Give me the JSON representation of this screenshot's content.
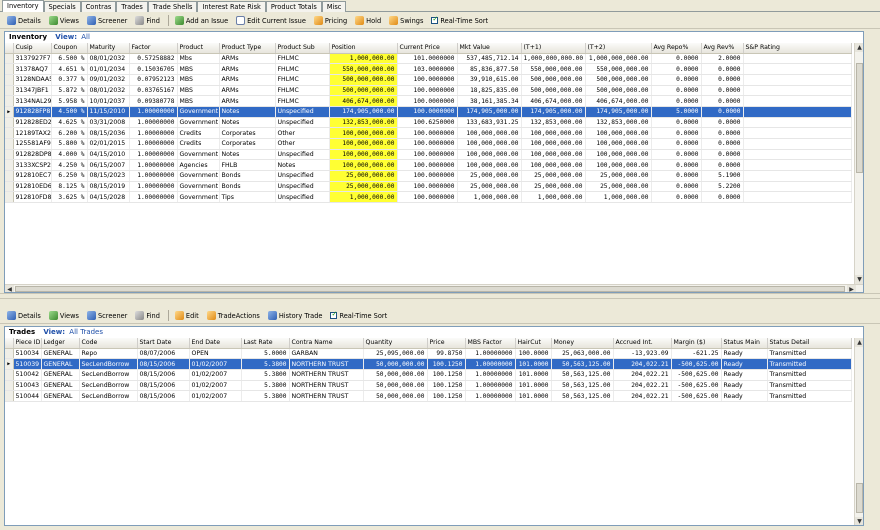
{
  "tabs": [
    {
      "label": "Inventory",
      "active": true
    },
    {
      "label": "Specials"
    },
    {
      "label": "Contras"
    },
    {
      "label": "Trades"
    },
    {
      "label": "Trade Shells"
    },
    {
      "label": "Interest Rate Risk"
    },
    {
      "label": "Product Totals"
    },
    {
      "label": "Misc"
    }
  ],
  "top_toolbar": {
    "details": "Details",
    "views": "Views",
    "screener": "Screener",
    "find": "Find",
    "add_issue": "Add an Issue",
    "edit_issue": "Edit Current Issue",
    "pricing": "Pricing",
    "hold": "Hold",
    "swings": "Swings",
    "realtime": "Real-Time Sort"
  },
  "inventory": {
    "title": "Inventory",
    "view_label": "View:",
    "view_value": "All",
    "columns": [
      "Cusip",
      "Coupon",
      "Maturity",
      "Factor",
      "Product",
      "Product Type",
      "Product Sub",
      "Position",
      "Current Price",
      "Mkt Value",
      "(T+1)",
      "(T+2)",
      "Avg Repo%",
      "Avg Rev%",
      "S&P Rating"
    ],
    "rows": [
      [
        "3137927F7",
        "6.500 %",
        "08/01/2032",
        "0.57258882",
        "Mbs",
        "ARMs",
        "FHLMC",
        "1,000,000.00",
        "101.0000000",
        "537,485,712.14",
        "1,000,000,000.00",
        "1,000,000,000.00",
        "0.0000",
        "2.0000",
        ""
      ],
      [
        "31378AQ7",
        "4.651 %",
        "01/01/2034",
        "0.15036705",
        "MBS",
        "ARMs",
        "FHLMC",
        "550,000,000.00",
        "103.0000000",
        "85,836,877.50",
        "550,000,000.00",
        "550,000,000.00",
        "0.0000",
        "0.0000",
        ""
      ],
      [
        "3128NDAA5",
        "0.377 %",
        "09/01/2032",
        "0.07952123",
        "MBS",
        "ARMs",
        "FHLMC",
        "500,000,000.00",
        "100.0000000",
        "39,910,615.00",
        "500,000,000.00",
        "500,000,000.00",
        "0.0000",
        "0.0000",
        ""
      ],
      [
        "31347JBF1",
        "5.872 %",
        "08/01/2032",
        "0.03765167",
        "MBS",
        "ARMs",
        "FHLMC",
        "500,000,000.00",
        "100.0000000",
        "18,825,835.00",
        "500,000,000.00",
        "500,000,000.00",
        "0.0000",
        "0.0000",
        ""
      ],
      [
        "3134NAL29",
        "5.958 %",
        "10/01/2037",
        "0.09380778",
        "MBS",
        "ARMs",
        "FHLMC",
        "406,674,000.00",
        "100.0000000",
        "38,161,385.34",
        "406,674,000.00",
        "406,674,000.00",
        "0.0000",
        "0.0000",
        ""
      ],
      [
        "912828FP8",
        "4.500 %",
        "11/15/2010",
        "1.00000000",
        "Government",
        "Notes",
        "Unspecified",
        "174,905,000.00",
        "100.0000000",
        "174,905,000.00",
        "174,905,000.00",
        "174,905,000.00",
        "5.0000",
        "0.0000",
        ""
      ],
      [
        "912828ED2",
        "4.625 %",
        "03/31/2008",
        "1.00000000",
        "Government",
        "Notes",
        "Unspecified",
        "132,853,000.00",
        "100.6250000",
        "133,683,931.25",
        "132,853,000.00",
        "132,853,000.00",
        "0.0000",
        "0.0000",
        ""
      ],
      [
        "12189TAX2",
        "6.200 %",
        "08/15/2036",
        "1.00000000",
        "Credits",
        "Corporates",
        "Other",
        "100,000,000.00",
        "100.0000000",
        "100,000,000.00",
        "100,000,000.00",
        "100,000,000.00",
        "0.0000",
        "0.0000",
        ""
      ],
      [
        "125581AF9",
        "5.800 %",
        "02/01/2015",
        "1.00000000",
        "Credits",
        "Corporates",
        "Other",
        "100,000,000.00",
        "100.0000000",
        "100,000,000.00",
        "100,000,000.00",
        "100,000,000.00",
        "0.0000",
        "0.0000",
        ""
      ],
      [
        "912828DP8",
        "4.000 %",
        "04/15/2010",
        "1.00000000",
        "Government",
        "Notes",
        "Unspecified",
        "100,000,000.00",
        "100.0000000",
        "100,000,000.00",
        "100,000,000.00",
        "100,000,000.00",
        "0.0000",
        "0.0000",
        ""
      ],
      [
        "3133XCSP2",
        "4.250 %",
        "06/15/2007",
        "1.00000000",
        "Agencies",
        "FHLB",
        "Notes",
        "100,000,000.00",
        "100.0000000",
        "100,000,000.00",
        "100,000,000.00",
        "100,000,000.00",
        "0.0000",
        "0.0000",
        ""
      ],
      [
        "912810EC7",
        "6.250 %",
        "08/15/2023",
        "1.00000000",
        "Government",
        "Bonds",
        "Unspecified",
        "25,000,000.00",
        "100.0000000",
        "25,000,000.00",
        "25,000,000.00",
        "25,000,000.00",
        "0.0000",
        "5.1900",
        ""
      ],
      [
        "912810ED6",
        "8.125 %",
        "08/15/2019",
        "1.00000000",
        "Government",
        "Bonds",
        "Unspecified",
        "25,000,000.00",
        "100.0000000",
        "25,000,000.00",
        "25,000,000.00",
        "25,000,000.00",
        "0.0000",
        "5.2200",
        ""
      ],
      [
        "912810FD8",
        "3.625 %",
        "04/15/2028",
        "1.00000000",
        "Government",
        "Tips",
        "Unspecified",
        "1,000,000.00",
        "100.0000000",
        "1,000,000.00",
        "1,000,000.00",
        "1,000,000.00",
        "0.0000",
        "0.0000",
        ""
      ]
    ],
    "selected_row": 5
  },
  "bottom_toolbar": {
    "details": "Details",
    "views": "Views",
    "screener": "Screener",
    "find": "Find",
    "edit": "Edit",
    "trade_actions": "TradeActions",
    "history": "History Trade",
    "realtime": "Real-Time Sort"
  },
  "trades": {
    "title": "Trades",
    "view_label": "View:",
    "view_value": "All Trades",
    "columns": [
      "Piece ID",
      "Ledger",
      "Code",
      "Start Date",
      "End Date",
      "Last Rate",
      "Contra Name",
      "Quantity",
      "Price",
      "MBS Factor",
      "HairCut",
      "Money",
      "Accrued Int.",
      "Margin ($)",
      "Status Main",
      "Status Detail"
    ],
    "rows": [
      [
        "510034",
        "GENERAL",
        "Repo",
        "08/07/2006",
        "OPEN",
        "5.0000",
        "GARBAN",
        "25,095,000.00",
        "99.8750",
        "1.00000000",
        "100.0000",
        "25,063,000.00",
        "-13,923.09",
        "-621.25",
        "Ready",
        "Transmitted"
      ],
      [
        "510039",
        "GENERAL",
        "SecLendBorrow",
        "08/15/2006",
        "01/02/2007",
        "5.3800",
        "NORTHERN TRUST",
        "50,000,000.00",
        "100.1250",
        "1.00000000",
        "101.0000",
        "50,563,125.00",
        "204,022.21",
        "-500,625.00",
        "Ready",
        "Transmitted"
      ],
      [
        "510042",
        "GENERAL",
        "SecLendBorrow",
        "08/15/2006",
        "01/02/2007",
        "5.3800",
        "NORTHERN TRUST",
        "50,000,000.00",
        "100.1250",
        "1.00000000",
        "101.0000",
        "50,563,125.00",
        "204,022.21",
        "-500,625.00",
        "Ready",
        "Transmitted"
      ],
      [
        "510043",
        "GENERAL",
        "SecLendBorrow",
        "08/15/2006",
        "01/02/2007",
        "5.3800",
        "NORTHERN TRUST",
        "50,000,000.00",
        "100.1250",
        "1.00000000",
        "101.0000",
        "50,563,125.00",
        "204,022.21",
        "-500,625.00",
        "Ready",
        "Transmitted"
      ],
      [
        "510044",
        "GENERAL",
        "SecLendBorrow",
        "08/15/2006",
        "01/02/2007",
        "5.3800",
        "NORTHERN TRUST",
        "50,000,000.00",
        "100.1250",
        "1.00000000",
        "101.0000",
        "50,563,125.00",
        "204,022.21",
        "-500,625.00",
        "Ready",
        "Transmitted"
      ]
    ],
    "selected_row": 1
  },
  "colors": {
    "highlight": "#ffff33",
    "selection": "#316ac5",
    "chrome": "#ece9d8"
  }
}
